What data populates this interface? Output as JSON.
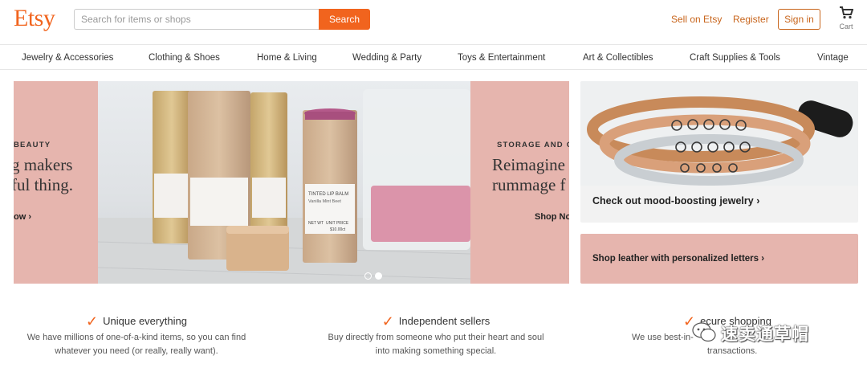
{
  "header": {
    "logo": "Etsy",
    "search": {
      "placeholder": "Search for items or shops",
      "button_label": "Search"
    },
    "sell_link": "Sell on Etsy",
    "register_link": "Register",
    "signin_button": "Sign in",
    "cart_label": "Cart"
  },
  "nav": {
    "items": [
      "Jewelry & Accessories",
      "Clothing & Shoes",
      "Home & Living",
      "Wedding & Party",
      "Toys & Entertainment",
      "Art & Collectibles",
      "Craft Supplies & Tools",
      "Vintage"
    ]
  },
  "hero": {
    "left": {
      "kicker": "BEAUTY",
      "headline_line1": "g makers",
      "headline_line2": "ful thing.",
      "link": "ow"
    },
    "right": {
      "kicker": "STORAGE AND OI",
      "headline_line1": "Reimagine",
      "headline_line2": "rummage f",
      "link": "Shop No"
    },
    "photo_labels": {
      "balm_title": "TINTED LIP BALM",
      "balm_flavor": "Vanilla Mint Beet",
      "net_wt": "NET WT",
      "unit_price": "UNIT PRICE",
      "price": "$10.00ct"
    }
  },
  "promos": {
    "jewelry": "Check out mood-boosting jewelry",
    "leather": "Shop leather with personalized letters"
  },
  "features": [
    {
      "title": "Unique everything",
      "desc": "We have millions of one-of-a-kind items, so you can find whatever you need (or really, really want)."
    },
    {
      "title": "Independent sellers",
      "desc": "Buy directly from someone who put their heart and soul into making something special."
    },
    {
      "title": "ecure shopping",
      "desc_line1": "We use best-in-",
      "desc_line2": "transactions."
    }
  ],
  "watermark": "速卖通草帽",
  "colors": {
    "brand": "#f1641e",
    "link": "#c8651c",
    "pink": "#e6b5ae"
  }
}
